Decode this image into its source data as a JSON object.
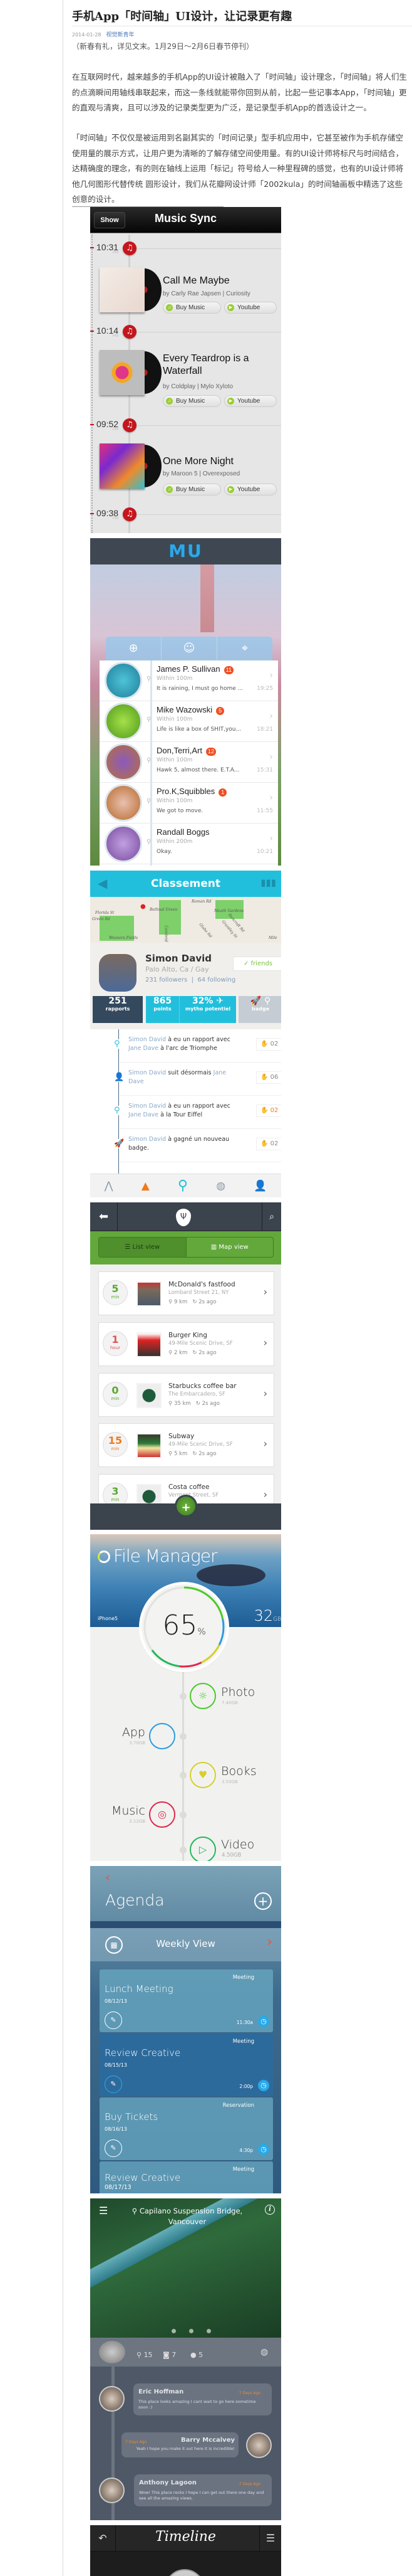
{
  "article": {
    "title": "手机App「时间轴」UI设计，让记录更有趣",
    "date": "2014-01-28",
    "source": "视觉新青年",
    "gift": "（新春有礼，详见文末。1月29日～2月6日春节停刊）",
    "p1": [
      "在互联网时代，越来越多的手机App的UI设计被融入了「时间轴」设计理念，「时间轴」将人们生",
      "的点滴瞬间用轴线串联起来，而这一条线就能带你回到从前，比起一些记事本App，「时间轴」更",
      "的直观与清爽，且可以涉及的记录类型更为广泛，是记录型手机App的首选设计之一。"
    ],
    "p2": [
      "「时间轴」不仅仅是被运用到名副其实的「时间记录」型手机应用中，它甚至被作为手机存储空",
      "使用量的展示方式，让用户更为清晰的了解存储空间使用量。有的UI设计师将标尺与时间结合，",
      "达精确度的理念，有的则在轴线上运用「标记」符号给人一种里程碑的感觉，也有的UI设计师将",
      "他几何图形代替传统 圆形设计，我们从花瓣网设计师「2002kula」的时间轴画板中精选了这些",
      "创意的设计。"
    ]
  },
  "music": {
    "back": "Show",
    "title": "Music Sync",
    "pm": "PM",
    "buy": "Buy Music",
    "youtube": "Youtube",
    "times": [
      "10:31",
      "10:14",
      "09:52",
      "09:38"
    ],
    "songs": [
      {
        "title": "Call Me Maybe",
        "sub": "by Carly Rae Japsen | Curiosity"
      },
      {
        "title": "Every Teardrop is a Waterfall",
        "sub": "by Coldplay | Mylo Xyloto"
      },
      {
        "title": "One More Night",
        "sub": "by Maroon 5 | Overexposed"
      }
    ],
    "accent": "#c4161c"
  },
  "mu": {
    "logo": "MU",
    "rows": [
      {
        "name": "James P. Sullivan",
        "badge": "11",
        "dist": "Within 100m",
        "msg": "It is raining, I must go home ...",
        "time": "19:25"
      },
      {
        "name": "Mike Wazowski",
        "badge": "5",
        "dist": "Within 100m",
        "msg": "Life is like a box of SHIT,you...",
        "time": "18:21"
      },
      {
        "name": "Don,Terri,Art",
        "badge": "12",
        "dist": "Within 100m",
        "msg": "Hawk 5, almost there. E.T.A...",
        "time": "15:31"
      },
      {
        "name": "Pro.K,Squibbles",
        "badge": "1",
        "dist": "Within 100m",
        "msg": "We got to move.",
        "time": "11:55"
      },
      {
        "name": "Randall Boggs",
        "dist": "Within 200m",
        "msg": "Okay.",
        "time": "10:21"
      }
    ]
  },
  "classement": {
    "title": "Classement",
    "map_labels": [
      "Florida St",
      "Green Rd",
      "Bethnal Green",
      "Roman Rd",
      "Meath Gardens",
      "Weavers Fields",
      "Globe Rd",
      "Grantley St",
      "Bancroft Rd",
      "Cambrid",
      "Mile"
    ],
    "name": "Simon David",
    "location": "Palo Alto, Ca  /  Gay",
    "followers": "231 followers",
    "following": "64 following",
    "friends": "✓ friends",
    "stats": [
      {
        "v": "251",
        "l": "rapports"
      },
      {
        "v": "865",
        "l": "points"
      },
      {
        "v": "32%",
        "l": "mytho potentiel"
      },
      {
        "l": "badge"
      }
    ],
    "feed": [
      {
        "a": "Simon David",
        "t1": " à eu un rapport avec ",
        "b": "Jane Dave",
        "t2": " à l'arc de Triomphe",
        "count": "02"
      },
      {
        "a": "Simon David",
        "t1": " suit désormais ",
        "b": "Jane Dave",
        "t2": "",
        "count": "06"
      },
      {
        "a": "Simon David",
        "t1": " à eu un rapport avec ",
        "b": "Jane Dave",
        "t2": " à la Tour Eiffel",
        "count": "02"
      },
      {
        "a": "Simon David",
        "t1": " à gagné un nouveau badge.",
        "b": "",
        "t2": "",
        "count": "02"
      }
    ],
    "accent": "#22bfdc"
  },
  "food": {
    "list_view": "List view",
    "map_view": "Map view",
    "places": [
      {
        "n": "5",
        "u": "min",
        "name": "McDonald's fastfood",
        "addr": "Lombard Street  21, NY",
        "dist": "9 km",
        "ago": "2s ago",
        "color": "#5aa832"
      },
      {
        "n": "1",
        "u": "hour",
        "name": "Burger King",
        "addr": "49-Mile Scenic Drive, SF",
        "dist": "2 km",
        "ago": "2s ago",
        "color": "#e05555"
      },
      {
        "n": "0",
        "u": "min",
        "name": "Starbucks coffee bar",
        "addr": "The Embarcadero, SF",
        "dist": "35 km",
        "ago": "2s ago",
        "color": "#5aa832"
      },
      {
        "n": "15",
        "u": "min",
        "name": "Subway",
        "addr": "49-Mile Scenic Drive, SF",
        "dist": "5 km",
        "ago": "2s ago",
        "color": "#f07a1a"
      },
      {
        "n": "3",
        "u": "min",
        "name": "Costa coffee",
        "addr": "Vermont Street, SF",
        "color": "#5aa832"
      }
    ]
  },
  "filemanager": {
    "title": "File Manager",
    "device": "iPhone5",
    "capacity": "32",
    "unit": "GB",
    "used_percent": "65",
    "pct": "%",
    "items": [
      {
        "l": "Photo",
        "s": "7.40GB",
        "color": "#4cc92a"
      },
      {
        "l": "App",
        "s": "3.70GB",
        "color": "#2a9be0"
      },
      {
        "l": "Books",
        "s": "3.50GB",
        "color": "#d8cf2a"
      },
      {
        "l": "Music",
        "s": "3.12GB",
        "color": "#e0284a"
      },
      {
        "l": "Video",
        "s": "4.50GB",
        "color": "#22b85a"
      }
    ]
  },
  "agenda": {
    "title": "Agenda",
    "view": "Weekly View",
    "events": [
      {
        "type": "Meeting",
        "title": "Lunch Meeting",
        "date": "08/12/13",
        "time": "11:30a"
      },
      {
        "type": "Meeting",
        "title": "Review Creative",
        "date": "08/15/13",
        "time": "2:00p"
      },
      {
        "type": "Reservation",
        "title": "Buy Tickets",
        "date": "08/16/13",
        "time": "4:30p"
      },
      {
        "type": "Meeting",
        "title": "Review Creative",
        "date": "08/17/13"
      }
    ]
  },
  "capilano": {
    "location": "Capilano Suspension Bridge, Vancouver",
    "checkins": "15",
    "photos": "7",
    "comments_count": "5",
    "comments": [
      {
        "name": "Eric Hoffman",
        "ago": "7 Days Ago",
        "text": "This place looks amazing I cant wait to go here sometime soon :)"
      },
      {
        "name": "Barry Mccalvey",
        "ago": "7 Days Ago",
        "text": "Yeah I hope you make it out here it is incredible!"
      },
      {
        "name": "Anthony Lagoon",
        "ago": "7 Days Ago",
        "text": "Wow! This place rocks I hope I can get out there one day and see all the amazing views."
      }
    ]
  },
  "timeline": {
    "title": "Timeline"
  }
}
